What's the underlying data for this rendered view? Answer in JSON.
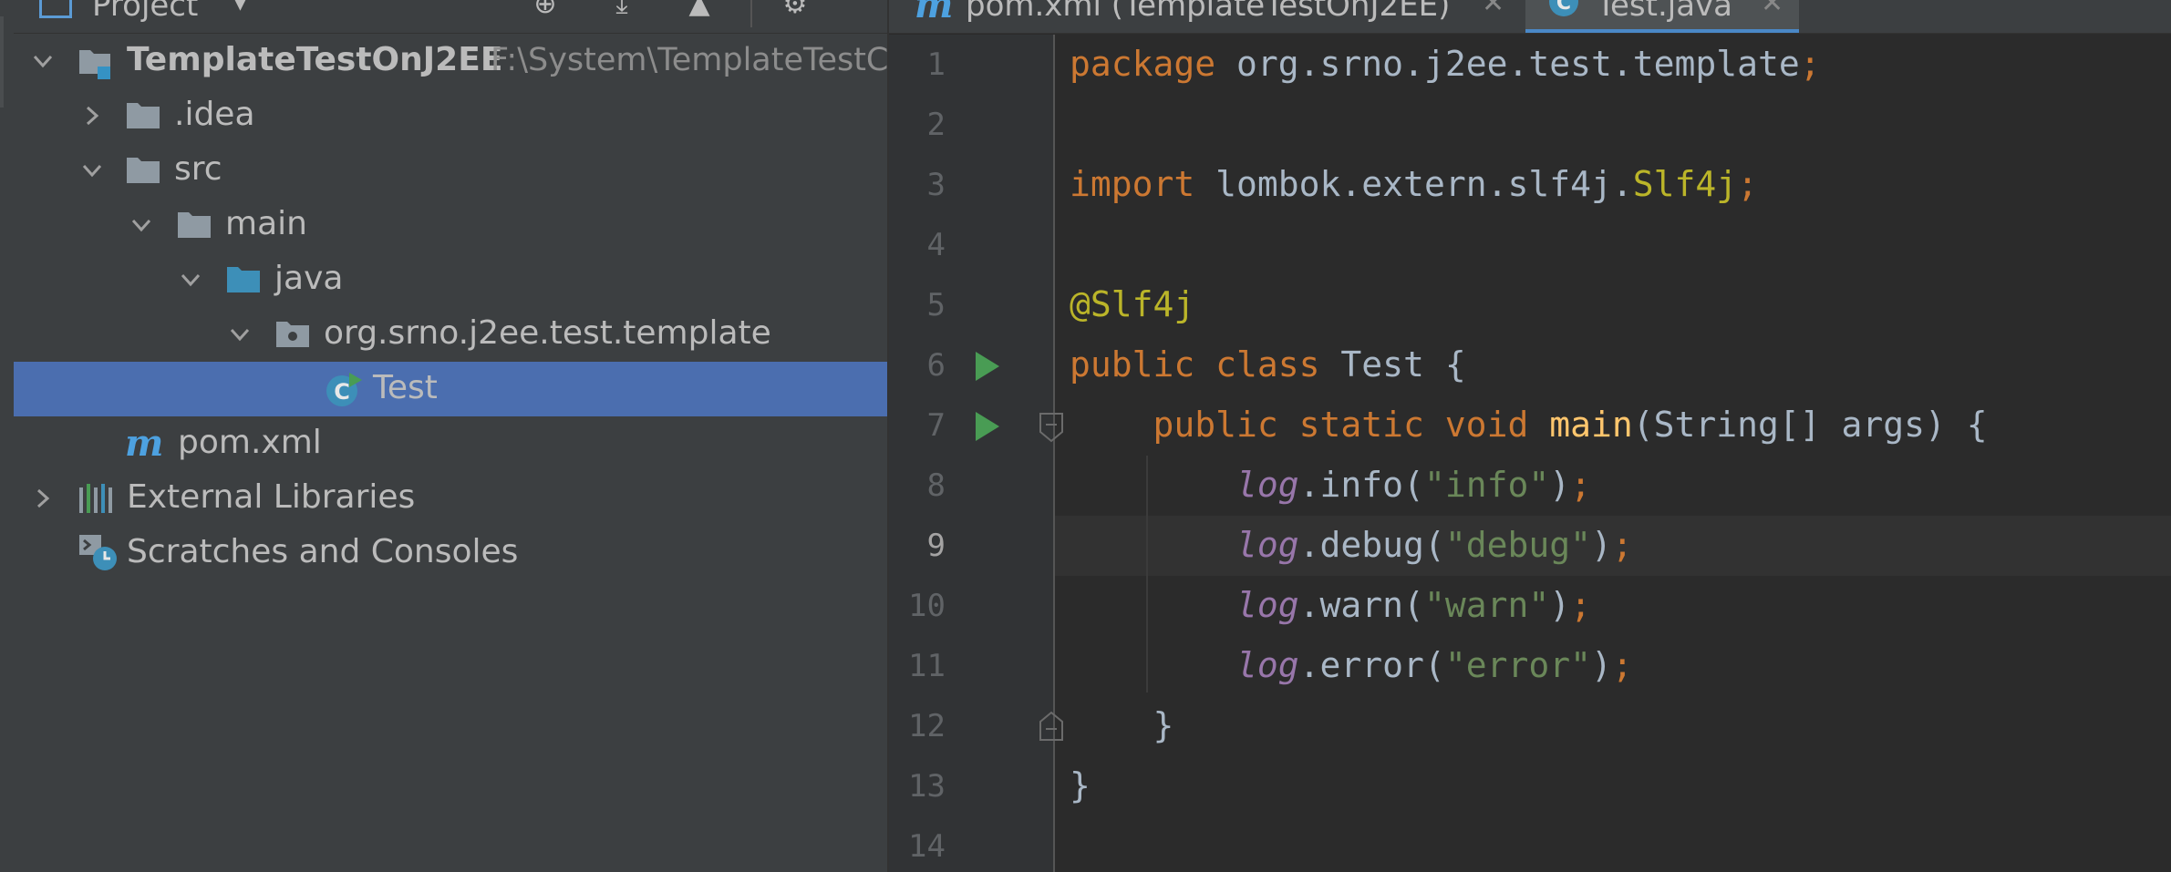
{
  "project_panel": {
    "title": "Project",
    "tree": [
      {
        "label": "TemplateTestOnJ2EE",
        "path": "F:\\System\\TemplateTestC",
        "bold": true
      },
      {
        "label": ".idea"
      },
      {
        "label": "src"
      },
      {
        "label": "main"
      },
      {
        "label": "java"
      },
      {
        "label": "org.srno.j2ee.test.template"
      },
      {
        "label": "Test"
      },
      {
        "label": "pom.xml"
      },
      {
        "label": "External Libraries"
      },
      {
        "label": "Scratches and Consoles"
      }
    ]
  },
  "editor": {
    "tabs": [
      {
        "label": "pom.xml (TemplateTestOnJ2EE)",
        "icon": "m",
        "active": false
      },
      {
        "label": "Test.java",
        "icon": "C",
        "active": true
      }
    ],
    "current_line": "9",
    "line_numbers": [
      "1",
      "2",
      "3",
      "4",
      "5",
      "6",
      "7",
      "8",
      "9",
      "10",
      "11",
      "12",
      "13",
      "14"
    ],
    "code": {
      "l1_kw": "package",
      "l1_rest": " org.srno.j2ee.test.template",
      "l1_semi": ";",
      "l3_kw": "import",
      "l3_rest": " lombok.extern.slf4j.",
      "l3_cls": "Slf4j",
      "l3_semi": ";",
      "l5_ann": "@Slf4j",
      "l6_kw": "public class",
      "l6_rest": " Test {",
      "l7_indent": "    ",
      "l7_kw": "public static void",
      "l7_sp": " ",
      "l7_mth": "main",
      "l7_rest": "(String[] args) {",
      "log": "log",
      "l8_call": ".info(",
      "l8_str": "\"info\"",
      "l9_call": ".debug(",
      "l9_str": "\"debug\"",
      "l10_call": ".warn(",
      "l10_str": "\"warn\"",
      "l11_call": ".error(",
      "l11_str": "\"error\"",
      "close_paren": ")",
      "semi": ";",
      "l12": "    }",
      "l13": "}",
      "indent8": "        "
    }
  },
  "colors": {
    "selection": "#4b6eaf",
    "keyword": "#cc7832",
    "annotation": "#bbb529",
    "string": "#6a8759",
    "field": "#9876aa",
    "method": "#ffc66d",
    "run": "#499c54"
  }
}
